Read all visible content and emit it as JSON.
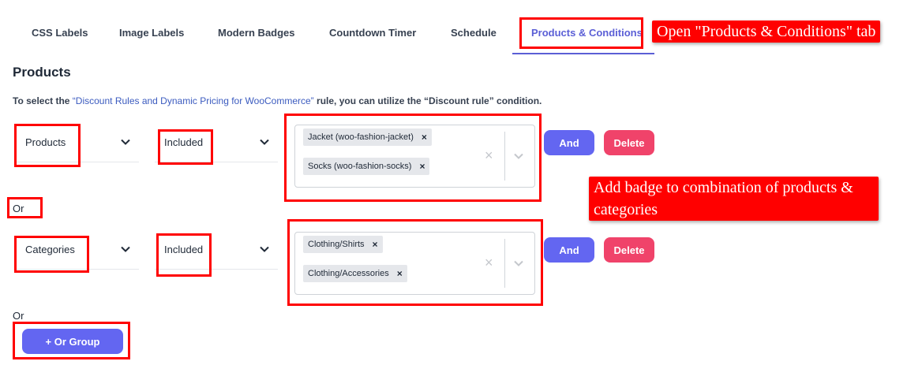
{
  "tabs": [
    {
      "label": "CSS Labels"
    },
    {
      "label": "Image Labels"
    },
    {
      "label": "Modern Badges"
    },
    {
      "label": "Countdown Timer"
    },
    {
      "label": "Schedule"
    },
    {
      "label": "Products & Conditions",
      "active": true
    }
  ],
  "section": {
    "title": "Products",
    "intro_prefix": "To select the ",
    "intro_link": "“Discount Rules and Dynamic Pricing for WooCommerce”",
    "intro_suffix": " rule, you can utilize the “Discount rule” condition."
  },
  "groups": [
    {
      "type": "Products",
      "mode": "Included",
      "chips": [
        "Jacket (woo-fashion-jacket)",
        "Socks (woo-fashion-socks)"
      ]
    },
    {
      "type": "Categories",
      "mode": "Included",
      "chips": [
        "Clothing/Shirts",
        "Clothing/Accessories"
      ]
    }
  ],
  "or_label": "Or",
  "buttons": {
    "and": "And",
    "delete": "Delete",
    "or_group": "+ Or Group"
  },
  "annotations": {
    "tab_callout": "Open \"Products & Conditions\" tab",
    "combo_callout": "Add badge to combination of products & categories"
  },
  "colors": {
    "accent": "#6366f1",
    "danger": "#f0436a",
    "annotation": "#ff0000"
  }
}
